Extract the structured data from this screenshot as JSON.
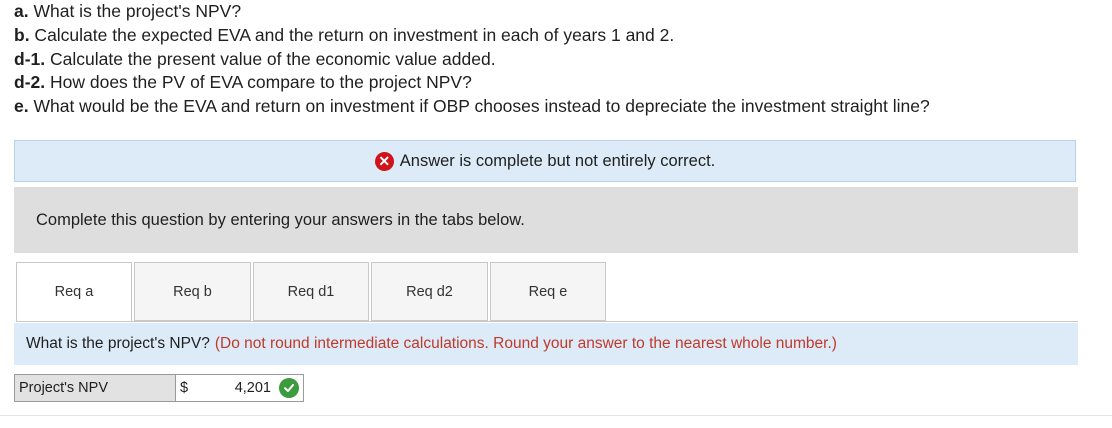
{
  "questions": [
    {
      "prefix": "a.",
      "text": " What is the project's NPV?"
    },
    {
      "prefix": "b.",
      "text": " Calculate the expected EVA and the return on investment in each of years 1 and 2."
    },
    {
      "prefix": "d-1.",
      "text": " Calculate the present value of the economic value added."
    },
    {
      "prefix": "d-2.",
      "text": " How does the PV of EVA compare to the project NPV?"
    },
    {
      "prefix": "e.",
      "text": " What would be the EVA and return on investment if OBP chooses instead to depreciate the investment straight line?"
    }
  ],
  "banner": {
    "icon": "x-circle-icon",
    "text": "Answer is complete but not entirely correct.",
    "color": "#d0121b"
  },
  "instructions": "Complete this question by entering your answers in the tabs below.",
  "tabs": [
    {
      "label": "Req a",
      "active": true
    },
    {
      "label": "Req b",
      "active": false
    },
    {
      "label": "Req d1",
      "active": false
    },
    {
      "label": "Req d2",
      "active": false
    },
    {
      "label": "Req e",
      "active": false
    }
  ],
  "prompt": {
    "text": "What is the project's NPV?",
    "note": "(Do not round intermediate calculations. Round your answer to the nearest whole number.)"
  },
  "answer": {
    "label": "Project's NPV",
    "currency": "$",
    "value": "4,201",
    "status_icon": "check-circle-icon",
    "status_color": "#3c9b3c"
  }
}
